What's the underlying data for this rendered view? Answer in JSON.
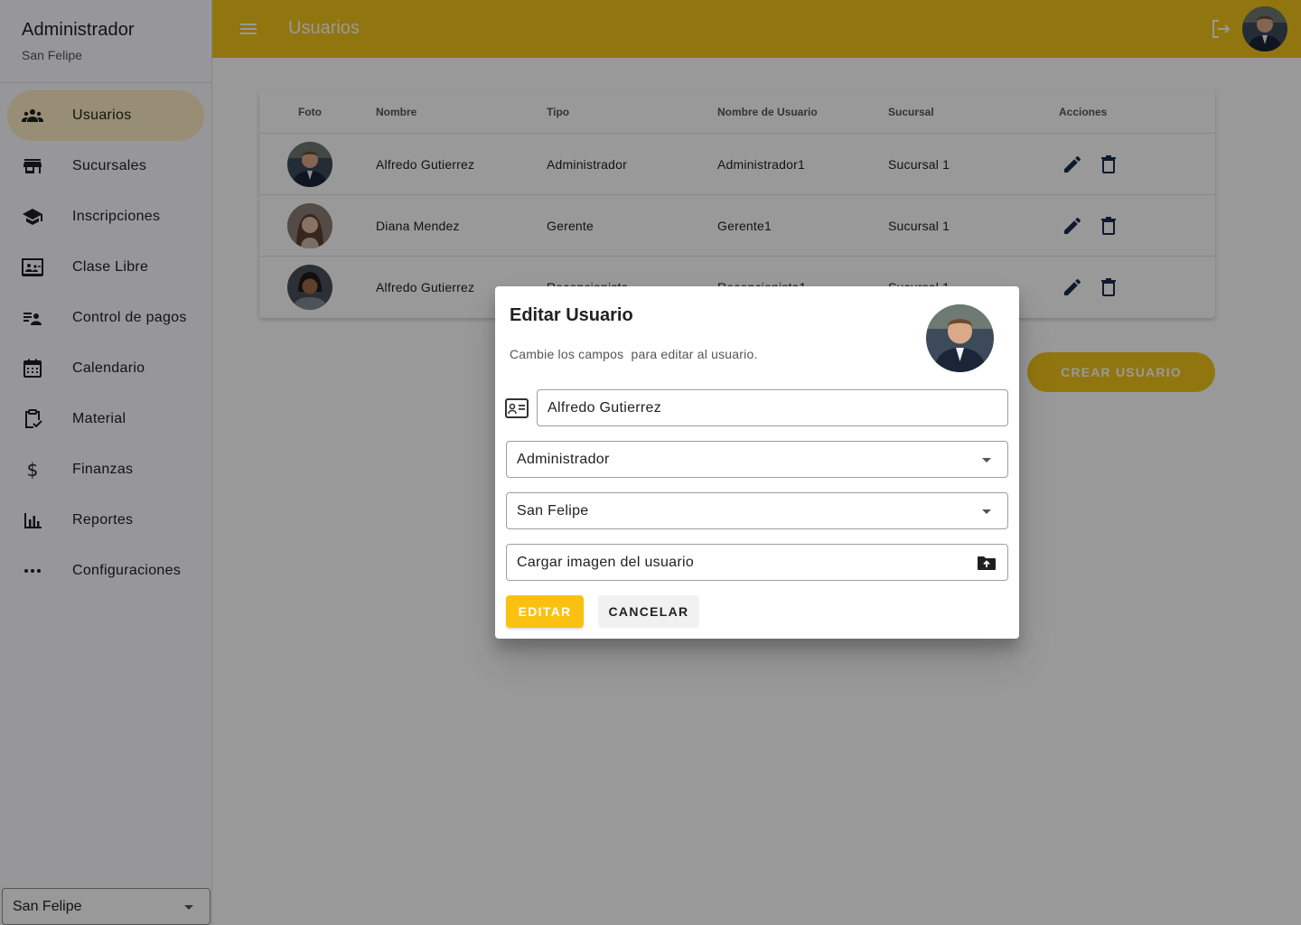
{
  "sidebar": {
    "title": "Administrador",
    "subtitle": "San Felipe",
    "items": [
      {
        "label": "Usuarios",
        "icon": "group-icon",
        "active": true
      },
      {
        "label": "Sucursales",
        "icon": "store-icon"
      },
      {
        "label": "Inscripciones",
        "icon": "school-icon"
      },
      {
        "label": "Clase Libre",
        "icon": "co-present-icon"
      },
      {
        "label": "Control de pagos",
        "icon": "person-list-icon"
      },
      {
        "label": "Calendario",
        "icon": "calendar-icon"
      },
      {
        "label": "Material",
        "icon": "clipboard-check-icon"
      },
      {
        "label": "Finanzas",
        "icon": "dollar-icon"
      },
      {
        "label": "Reportes",
        "icon": "bar-chart-icon"
      },
      {
        "label": "Configuraciones",
        "icon": "more-horiz-icon"
      }
    ],
    "branch_select": "San Felipe"
  },
  "topbar": {
    "title": "Usuarios",
    "accent": "#f2c31a"
  },
  "table": {
    "headers": [
      "Foto",
      "Nombre",
      "Tipo",
      "Nombre de Usuario",
      "Sucursal",
      "Acciones"
    ],
    "rows": [
      {
        "nombre": "Alfredo Gutierrez",
        "tipo": "Administrador",
        "usuario": "Administrador1",
        "sucursal": "Sucursal 1"
      },
      {
        "nombre": "Diana Mendez",
        "tipo": "Gerente",
        "usuario": "Gerente1",
        "sucursal": "Sucursal 1"
      },
      {
        "nombre": "Alfredo Gutierrez",
        "tipo": "Recepcionista",
        "usuario": "Recepcionista1",
        "sucursal": "Sucursal 1"
      }
    ]
  },
  "create_button": "CREAR USUARIO",
  "dialog": {
    "title": "Editar Usuario",
    "subtitle": "Cambie los campos  para editar al usuario.",
    "name_value": "Alfredo Gutierrez",
    "type_value": "Administrador",
    "branch_value": "San Felipe",
    "upload_label": "Cargar imagen del usuario",
    "edit_button": "EDITAR",
    "cancel_button": "CANCELAR"
  }
}
